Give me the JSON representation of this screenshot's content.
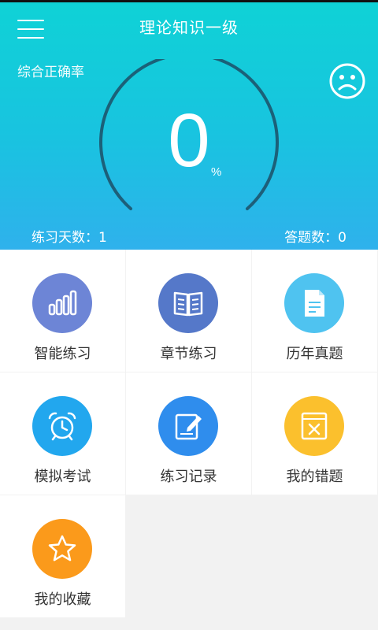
{
  "header": {
    "title": "理论知识一级",
    "accuracy_label": "综合正确率"
  },
  "gauge": {
    "value": "0",
    "unit": "%"
  },
  "stats": {
    "practice_days": "练习天数：1",
    "answer_count": "答题数：0"
  },
  "tiles": [
    {
      "label": "智能练习",
      "icon": "bar-chart-icon",
      "color": "#6d85d6"
    },
    {
      "label": "章节练习",
      "icon": "book-icon",
      "color": "#5578c9"
    },
    {
      "label": "历年真题",
      "icon": "document-icon",
      "color": "#4fc3f0"
    },
    {
      "label": "模拟考试",
      "icon": "alarm-clock-icon",
      "color": "#22a7ee"
    },
    {
      "label": "练习记录",
      "icon": "edit-note-icon",
      "color": "#2f8ded"
    },
    {
      "label": "我的错题",
      "icon": "wrong-box-icon",
      "color": "#fbc02d"
    },
    {
      "label": "我的收藏",
      "icon": "star-icon",
      "color": "#fb9a1b"
    }
  ]
}
